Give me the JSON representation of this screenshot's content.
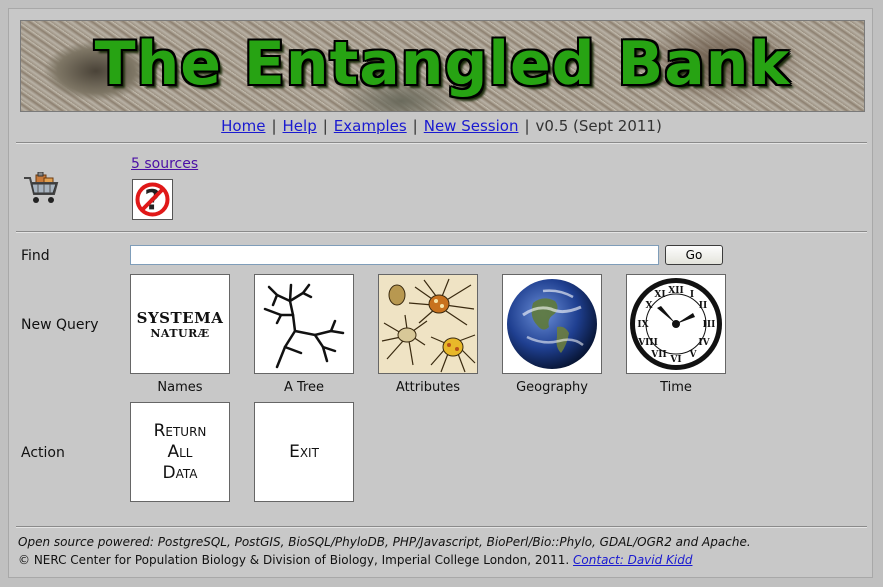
{
  "banner": {
    "title": "The Entangled Bank"
  },
  "nav": {
    "home": "Home",
    "help": "Help",
    "examples": "Examples",
    "new_session": "New Session",
    "separator": "|",
    "version": "v0.5 (Sept 2011)"
  },
  "basket": {
    "icon": "shopping-cart-icon",
    "sources_link": "5 sources",
    "status_icon": "no-help-icon"
  },
  "find": {
    "label": "Find",
    "value": "",
    "placeholder": "",
    "go_label": "Go"
  },
  "new_query": {
    "label": "New Query",
    "tiles": [
      {
        "caption": "Names",
        "image_text_1": "SYSTEMA",
        "image_text_2": "NATURÆ",
        "icon": "systema-naturae-image"
      },
      {
        "caption": "A Tree",
        "icon": "tree-image"
      },
      {
        "caption": "Attributes",
        "icon": "spiders-image"
      },
      {
        "caption": "Geography",
        "icon": "earth-globe-image"
      },
      {
        "caption": "Time",
        "icon": "clock-image"
      }
    ]
  },
  "action": {
    "label": "Action",
    "tiles": [
      {
        "text_line1": "Return",
        "text_line2": "All",
        "text_line3": "Data"
      },
      {
        "text_line1": "Exit"
      }
    ]
  },
  "footer": {
    "powered": "Open source powered: PostgreSQL, PostGIS, BioSQL/PhyloDB, PHP/Javascript, BioPerl/Bio::Phylo, GDAL/OGR2 and Apache.",
    "copyright": "© NERC Center for Population Biology & Division of Biology, Imperial College London, 2011.",
    "contact": "Contact: David Kidd"
  },
  "colors": {
    "background": "#c0c0c0",
    "link": "#1a1ad0",
    "visited_link": "#4b0fa6",
    "title_green": "#27a313"
  }
}
